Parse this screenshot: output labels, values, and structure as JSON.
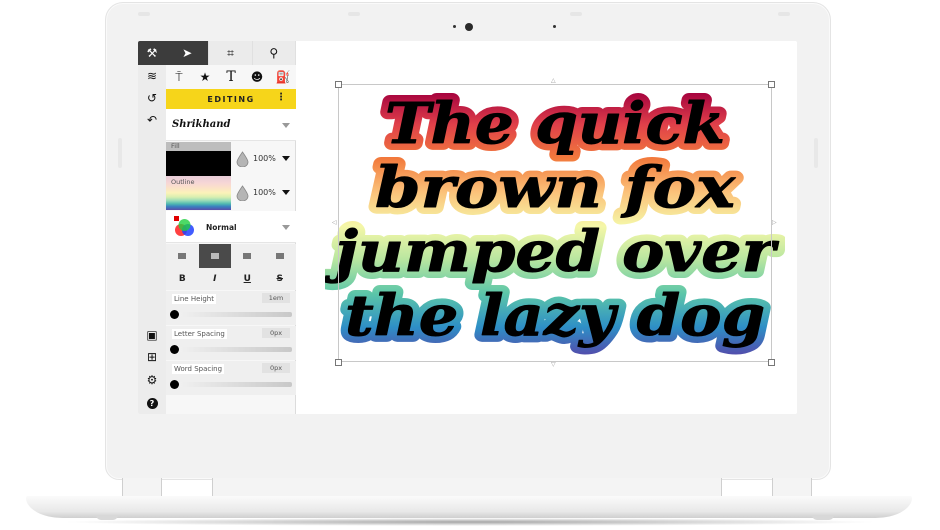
{
  "app": {
    "toolbar_top": [
      {
        "icon": "tools-icon",
        "glyph": "⚒"
      },
      {
        "icon": "pointer-icon",
        "glyph": "➤"
      },
      {
        "icon": "crop-icon",
        "glyph": "⌗"
      },
      {
        "icon": "search-icon",
        "glyph": "⚲"
      }
    ],
    "toolbar_second": [
      {
        "icon": "paint-roller-icon",
        "glyph": "⍑"
      },
      {
        "icon": "star-icon",
        "glyph": "★"
      },
      {
        "icon": "text-icon",
        "glyph": "T"
      },
      {
        "icon": "emoji-icon",
        "glyph": "☻"
      },
      {
        "icon": "fill-bucket-icon",
        "glyph": "⛽"
      }
    ],
    "rail_top": [
      {
        "icon": "layers-icon",
        "glyph": "≋"
      },
      {
        "icon": "history-icon",
        "glyph": "↺"
      },
      {
        "icon": "undo-icon",
        "glyph": "↶"
      }
    ],
    "rail_bottom": [
      {
        "icon": "save-icon",
        "glyph": "▣"
      },
      {
        "icon": "new-folder-icon",
        "glyph": "⊞"
      },
      {
        "icon": "settings-icon",
        "glyph": "⚙"
      },
      {
        "icon": "help-icon",
        "glyph": "?"
      }
    ],
    "editing_label": "EDITING",
    "more_glyph": "⋮",
    "font_name": "Shrikhand",
    "fill": {
      "label": "Fill",
      "color": "#000000",
      "opacity": "100%"
    },
    "outline": {
      "label": "Outline",
      "opacity": "100%"
    },
    "blend_mode": "Normal",
    "align_options": [
      "align-left",
      "align-center",
      "align-right",
      "align-justify"
    ],
    "align_active": "align-center",
    "style_buttons": [
      "B",
      "I",
      "U",
      "S"
    ],
    "sliders": [
      {
        "label": "Line Height",
        "value": "1em",
        "position": 0
      },
      {
        "label": "Letter Spacing",
        "value": "0px",
        "position": 0
      },
      {
        "label": "Word Spacing",
        "value": "0px",
        "position": 0
      }
    ],
    "accent_color": "#f6d51a"
  },
  "canvas": {
    "lines": [
      "The quick",
      "brown fox",
      "jumped over",
      "the lazy dog"
    ],
    "fill_color": "#000000",
    "outline_gradient": [
      "#a3003e",
      "#e0404a",
      "#f27a3c",
      "#fbc27a",
      "#f5f7a8",
      "#b8e6a0",
      "#5cc6a8",
      "#2e8fc6",
      "#5a3ea6"
    ]
  }
}
